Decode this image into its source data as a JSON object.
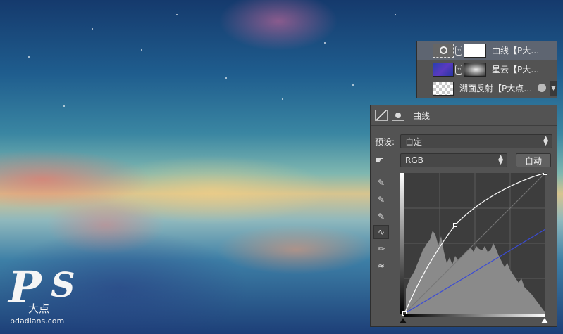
{
  "watermark": {
    "text": "pdadians.com",
    "logo": "P大点S"
  },
  "layers": [
    {
      "name": "曲线【P大…",
      "selected": true,
      "thumb_icon": "curves-adjustment-icon"
    },
    {
      "name": "星云【P大…",
      "selected": false,
      "thumb_icon": "nebula-thumbnail"
    },
    {
      "name": "湖面反射【P大点…",
      "selected": false,
      "thumb_icon": "lake-thumbnail"
    }
  ],
  "properties": {
    "title": "曲线",
    "preset_label": "预设:",
    "preset_value": "自定",
    "channel_value": "RGB",
    "auto_button": "自动"
  },
  "curves": {
    "white_curve": [
      [
        0,
        0
      ],
      [
        0.36,
        0.63
      ],
      [
        1,
        1
      ]
    ],
    "blue_curve": [
      [
        0,
        0
      ],
      [
        1,
        0.6
      ]
    ]
  },
  "colors": {
    "panel_bg": "#535353",
    "selected_layer": "#5e6571",
    "curve_white": "#ffffff",
    "curve_blue": "#3a4bd6"
  }
}
